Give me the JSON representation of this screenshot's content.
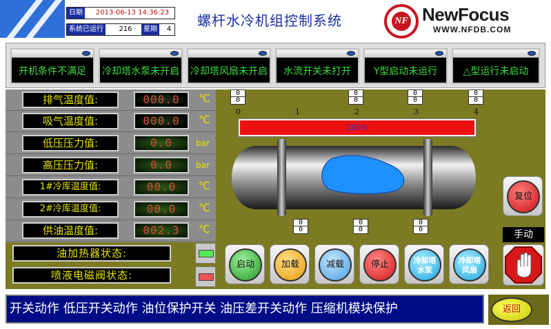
{
  "header": {
    "date_label": "日期",
    "date_value": "2013-06-13 14:36:23",
    "runtime_label": "系统已运行",
    "runtime_value": "216",
    "weekday_label": "星期",
    "weekday_value": "4",
    "title": "螺杆水冷机组控制系统",
    "logo_mark": "NF",
    "logo_name": "NewFocus",
    "logo_url": "WWW.NFDB.COM"
  },
  "alarms": [
    "开机条件不满足",
    "冷却塔水泵未开启",
    "冷却塔风扇未开启",
    "水流开关未打开",
    "Y型启动未运行",
    "△型运行未启动"
  ],
  "sensors": [
    {
      "label": "排气温度值:",
      "value": "000.0",
      "unit": "℃",
      "style": "red"
    },
    {
      "label": "吸气温度值:",
      "value": "000.0",
      "unit": "℃",
      "style": "red"
    },
    {
      "label": "低压压力值:",
      "value": "0.0",
      "unit": "bar",
      "style": "green"
    },
    {
      "label": "高压压力值:",
      "value": "0.0",
      "unit": "bar",
      "style": "green"
    },
    {
      "label": "1#冷库温度值:",
      "value": "00.0",
      "unit": "℃",
      "style": "green"
    },
    {
      "label": "2#冷库温度值:",
      "value": "00.0",
      "unit": "℃",
      "style": "green"
    },
    {
      "label": "供油温度值:",
      "value": "002.3",
      "unit": "℃",
      "style": "green"
    }
  ],
  "statuses": [
    {
      "label": "油加热器状态:",
      "lamp_color": "#54e854"
    },
    {
      "label": "喷液电磁阀状态:",
      "lamp_color": "#e85454"
    }
  ],
  "compressor": {
    "top_counters": [
      {
        "top": "0",
        "bottom": "0"
      },
      {
        "top": "0",
        "bottom": "0"
      },
      {
        "top": "0",
        "bottom": "0"
      },
      {
        "top": "0",
        "bottom": "0"
      }
    ],
    "axis_ticks": [
      "0",
      "1",
      "2",
      "3",
      "4"
    ],
    "progress_text": "100%",
    "progress_percent": 100,
    "bottom_counters": [
      {
        "top": "0",
        "bottom": "0"
      },
      {
        "top": "0",
        "bottom": "0"
      },
      {
        "top": "0",
        "bottom": "0"
      }
    ]
  },
  "controls": {
    "reset": "复位",
    "start": "启动",
    "load": "加载",
    "unload": "减载",
    "stop": "停止",
    "tower_pump": "冷却塔\n水泵",
    "tower_fan": "冷却塔\n风扇",
    "mode": "手动"
  },
  "colors": {
    "start": "#2aa82a",
    "load": "#f0a810",
    "unload": "#5aa8e8",
    "stop": "#e02020",
    "tower": "#30b8e8",
    "reset": "#e02020"
  },
  "ticker": "开关动作   低压开关动作   油位保护开关   油压差开关动作   压缩机模块保护",
  "back_label": "返回"
}
